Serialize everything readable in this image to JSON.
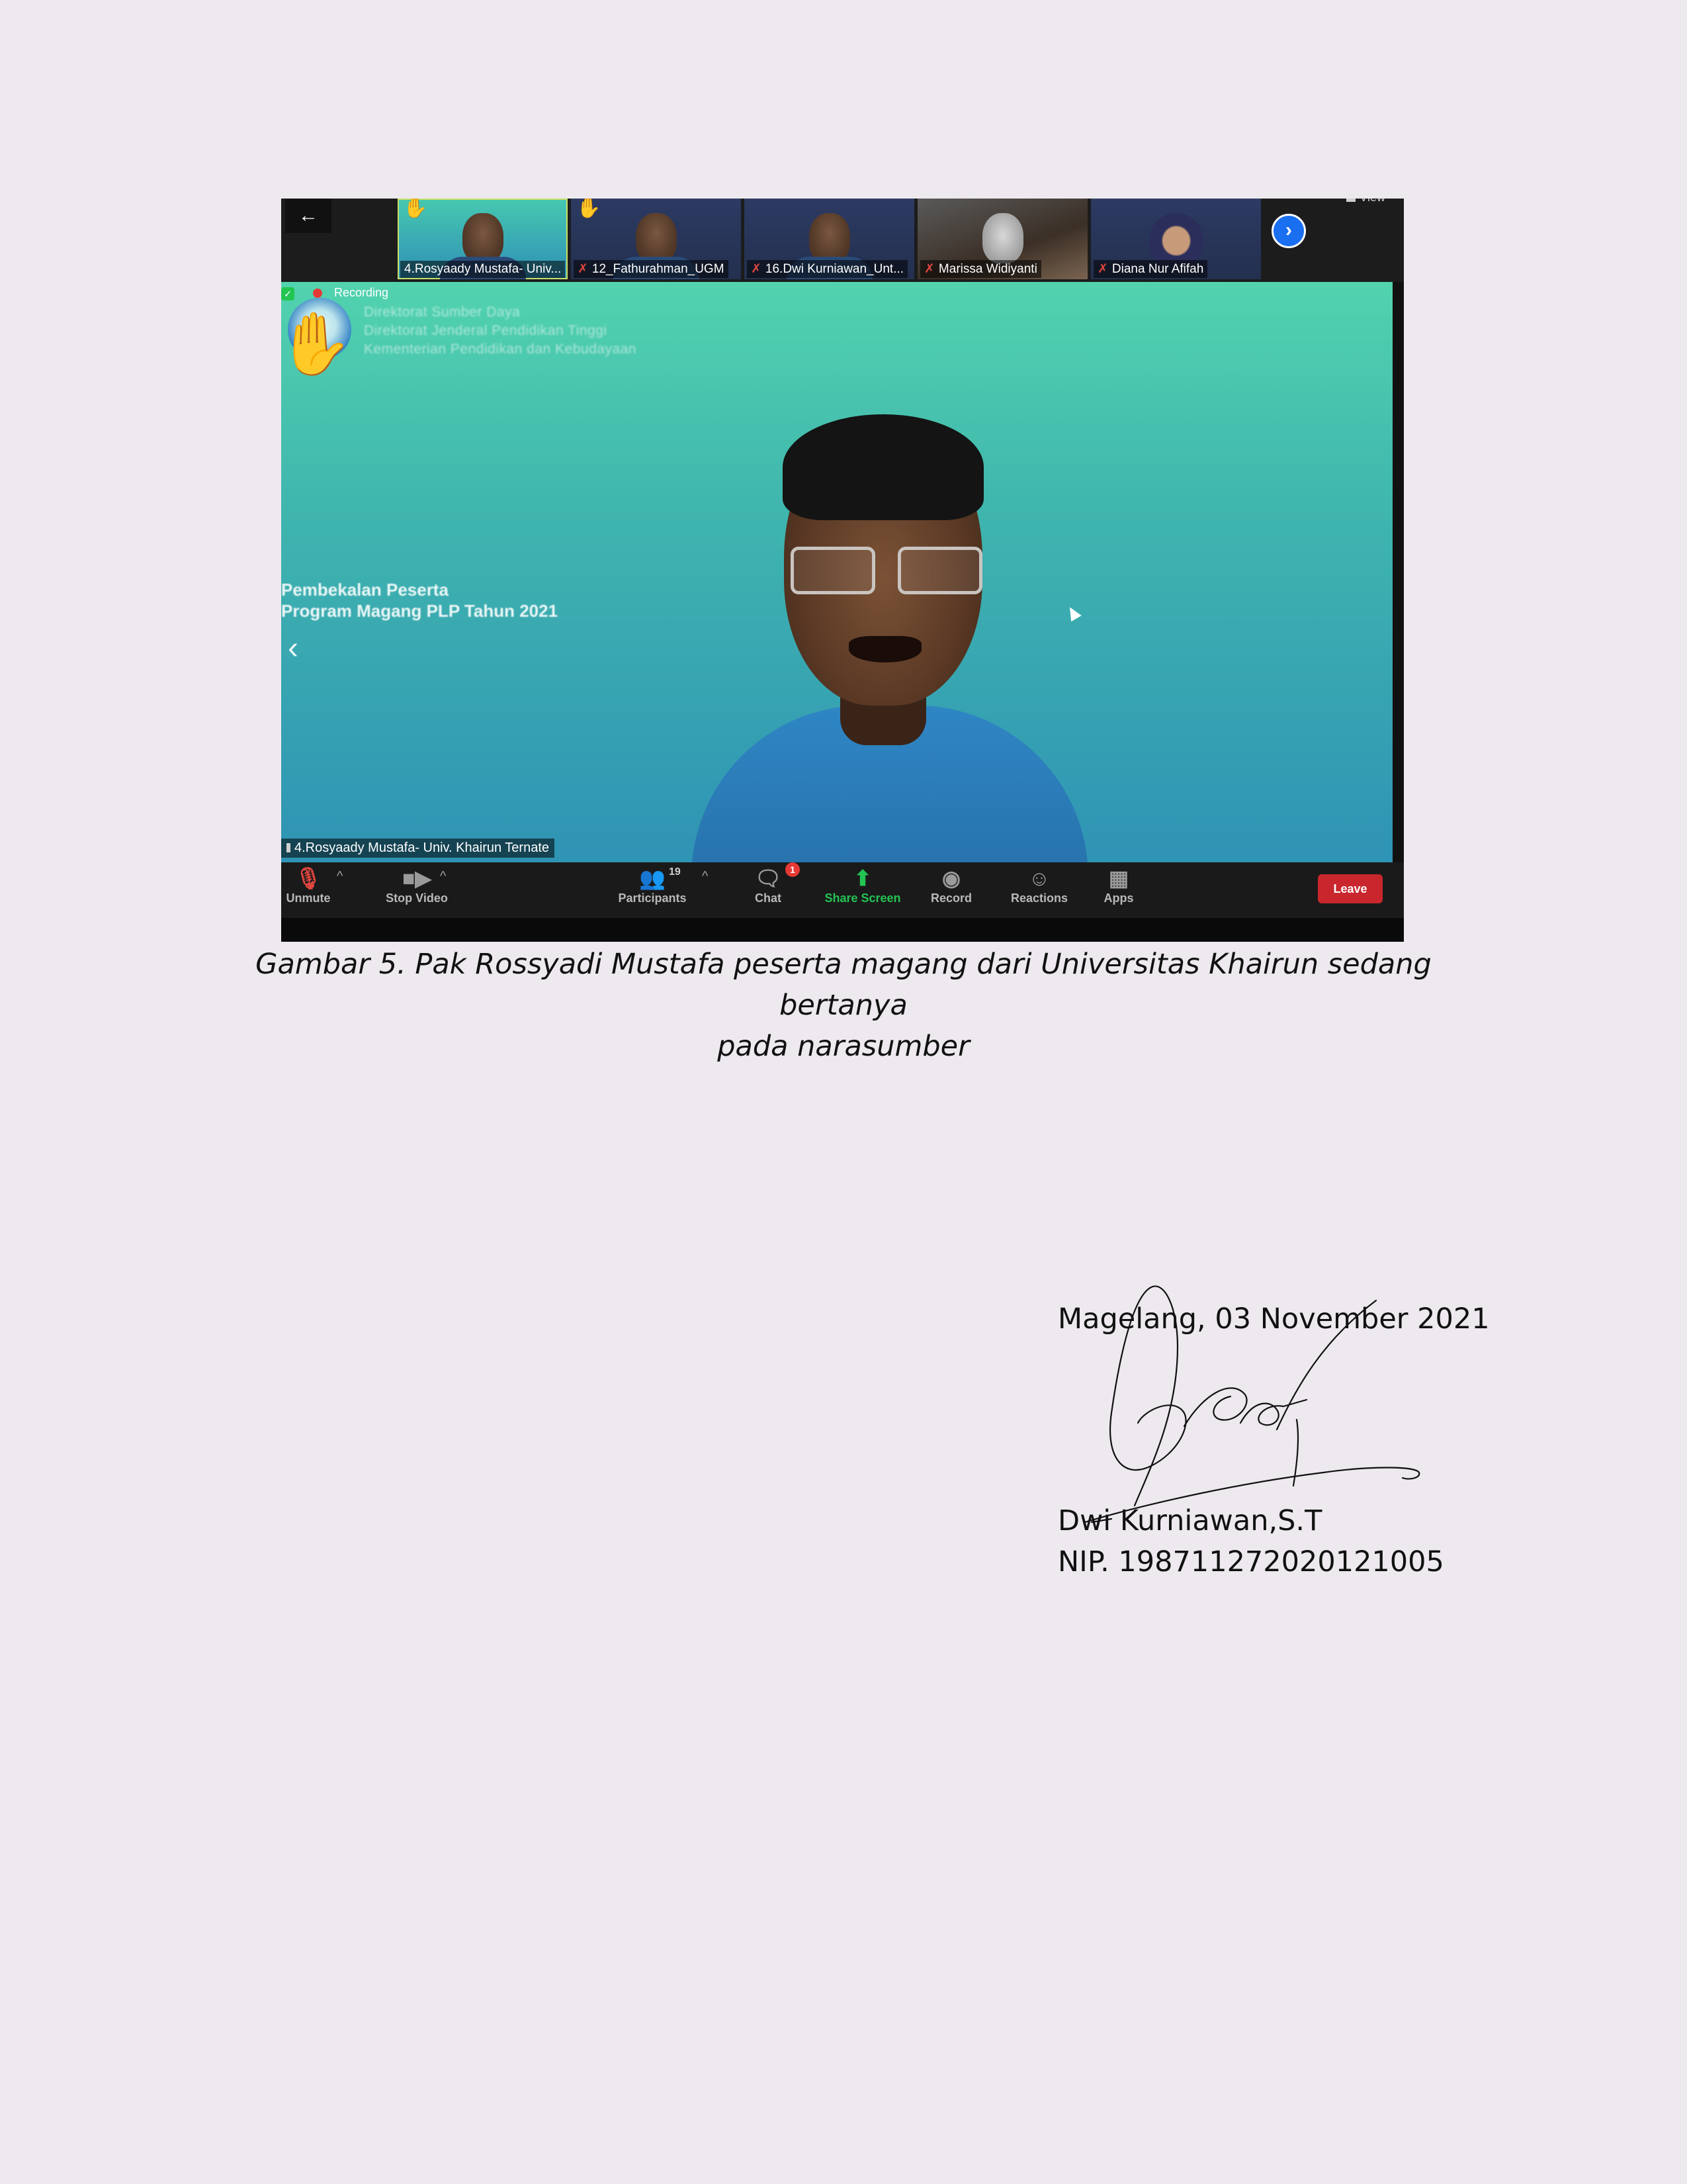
{
  "zoom": {
    "back_icon": "arrow-left-icon",
    "view_label": "View",
    "thumbnails": [
      {
        "name": "4.Rosyaady Mustafa- Univ...",
        "muted": false,
        "hand": true,
        "style": "active"
      },
      {
        "name": "12_Fathurahman_UGM",
        "muted": true,
        "hand": true,
        "style": "slide"
      },
      {
        "name": "16.Dwi Kurniawan_Unt...",
        "muted": true,
        "hand": false,
        "style": "slide"
      },
      {
        "name": "Marissa Widiyanti",
        "muted": true,
        "hand": false,
        "style": "video"
      },
      {
        "name": "Diana Nur Afifah",
        "muted": true,
        "hand": false,
        "style": "hijab"
      }
    ],
    "recording_label": "Recording",
    "slide_header_lines": [
      "Direktorat Sumber Daya",
      "Direktorat Jenderal Pendidikan Tinggi",
      "Kementerian Pendidikan dan Kebudayaan"
    ],
    "slide_title_lines": [
      "Pembekalan Peserta",
      "Program Magang PLP Tahun 2021"
    ],
    "speaker_name_tag": "4.Rosyaady Mustafa- Univ. Khairun Ternate",
    "toolbar": {
      "unmute": "Unmute",
      "stop_video": "Stop Video",
      "participants": "Participants",
      "participant_count": "19",
      "chat": "Chat",
      "chat_badge": "1",
      "share_screen": "Share Screen",
      "record": "Record",
      "reactions": "Reactions",
      "apps": "Apps",
      "leave": "Leave"
    }
  },
  "caption": {
    "line1": "Gambar 5. Pak Rossyadi Mustafa peserta magang dari Universitas Khairun sedang bertanya",
    "line2": "pada narasumber"
  },
  "signature_block": {
    "place_date": "Magelang, 03 November 2021",
    "name": "Dwi Kurniawan,S.T",
    "nip": "NIP. 198711272020121005"
  }
}
